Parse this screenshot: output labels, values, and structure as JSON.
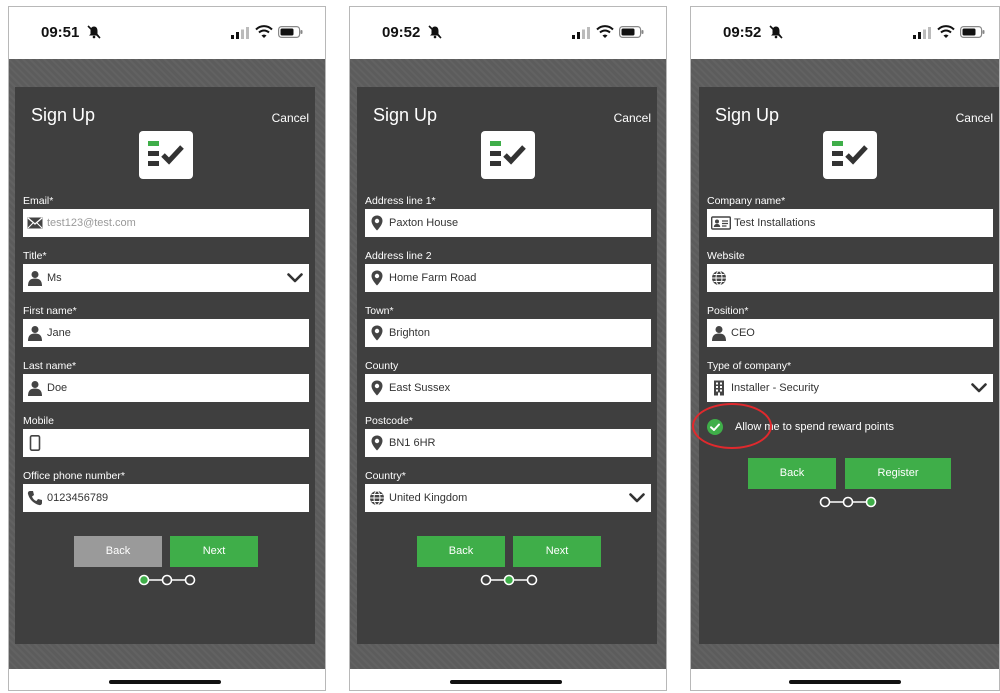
{
  "screen1": {
    "time": "09:51",
    "title": "Sign Up",
    "cancel": "Cancel",
    "fields": [
      {
        "label": "Email*",
        "value": "test123@test.com",
        "icon": "envelope-icon"
      },
      {
        "label": "Title*",
        "value": "Ms",
        "icon": "person-icon"
      },
      {
        "label": "First name*",
        "value": "Jane",
        "icon": "person-icon"
      },
      {
        "label": "Last name*",
        "value": "Doe",
        "icon": "person-icon"
      },
      {
        "label": "Mobile",
        "value": "",
        "icon": "mobile-icon"
      },
      {
        "label": "Office phone number*",
        "value": "0123456789",
        "icon": "phone-icon"
      }
    ],
    "back": "Back",
    "next": "Next",
    "step": 1
  },
  "screen2": {
    "time": "09:52",
    "title": "Sign Up",
    "cancel": "Cancel",
    "fields": [
      {
        "label": "Address line 1*",
        "value": "Paxton House",
        "icon": "location-pin-icon"
      },
      {
        "label": "Address line 2",
        "value": "Home Farm Road",
        "icon": "location-pin-icon"
      },
      {
        "label": "Town*",
        "value": "Brighton",
        "icon": "location-pin-icon"
      },
      {
        "label": "County",
        "value": "East Sussex",
        "icon": "location-pin-icon"
      },
      {
        "label": "Postcode*",
        "value": "BN1 6HR",
        "icon": "location-pin-icon"
      },
      {
        "label": "Country*",
        "value": "United Kingdom",
        "icon": "globe-icon"
      }
    ],
    "back": "Back",
    "next": "Next",
    "step": 2
  },
  "screen3": {
    "time": "09:52",
    "title": "Sign Up",
    "cancel": "Cancel",
    "fields": [
      {
        "label": "Company name*",
        "value": "Test Installations",
        "icon": "id-card-icon"
      },
      {
        "label": "Website",
        "value": "",
        "icon": "globe-icon"
      },
      {
        "label": "Position*",
        "value": "CEO",
        "icon": "person-icon"
      },
      {
        "label": "Type of company*",
        "value": "Installer - Security",
        "icon": "building-icon"
      }
    ],
    "checkbox_label": "Allow me to spend reward points",
    "back": "Back",
    "register": "Register",
    "step": 3
  },
  "colors": {
    "accent": "#3fae49",
    "panel": "#3f3f3f",
    "disabled": "#9a9a9a",
    "highlight": "#e0292d"
  }
}
